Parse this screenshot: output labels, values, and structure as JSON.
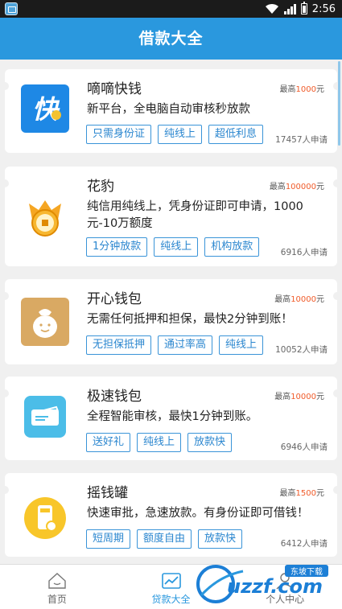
{
  "status": {
    "time": "2:56"
  },
  "header": {
    "title": "借款大全"
  },
  "cards": [
    {
      "name": "嘀嘀快钱",
      "max_prefix": "最高",
      "max_amount": "1000",
      "max_unit": "元",
      "desc": "新平台，全电脑自动审核秒放款",
      "tags": [
        "只需身份证",
        "纯线上",
        "超低利息"
      ],
      "applicants": "17457人申请",
      "icon": "kuai-icon",
      "logo_char": "快"
    },
    {
      "name": "花豹",
      "max_prefix": "最高",
      "max_amount": "100000",
      "max_unit": "元",
      "desc": "纯信用纯线上，凭身份证即可申请，1000元-10万额度",
      "tags": [
        "1分钟放款",
        "纯线上",
        "机构放款"
      ],
      "applicants": "6916人申请",
      "icon": "leopard-coin-icon"
    },
    {
      "name": "开心钱包",
      "max_prefix": "最高",
      "max_amount": "10000",
      "max_unit": "元",
      "desc": "无需任何抵押和担保，最快2分钟到账！",
      "tags": [
        "无担保抵押",
        "通过率高",
        "纯线上"
      ],
      "applicants": "10052人申请",
      "icon": "money-bag-icon"
    },
    {
      "name": "极速钱包",
      "max_prefix": "最高",
      "max_amount": "10000",
      "max_unit": "元",
      "desc": "全程智能审核，最快1分钟到账。",
      "tags": [
        "送好礼",
        "纯线上",
        "放款快"
      ],
      "applicants": "6946人申请",
      "icon": "wallet-icon"
    },
    {
      "name": "摇钱罐",
      "max_prefix": "最高",
      "max_amount": "1500",
      "max_unit": "元",
      "desc": "快速审批，急速放款。有身份证即可借钱！",
      "tags": [
        "短周期",
        "额度自由",
        "放款快"
      ],
      "applicants": "6412人申请",
      "icon": "jar-icon"
    }
  ],
  "nav": [
    {
      "label": "首页",
      "icon": "home-icon",
      "active": false
    },
    {
      "label": "贷款大全",
      "icon": "chart-icon",
      "active": true
    },
    {
      "label": "个人中心",
      "icon": "user-icon",
      "active": false
    }
  ],
  "watermark": {
    "text": "uzzf.com",
    "sub": "东坡下载"
  },
  "colors": {
    "header": "#2a98de",
    "accent_amount": "#f05a28",
    "tag_border": "#3a94d8"
  }
}
